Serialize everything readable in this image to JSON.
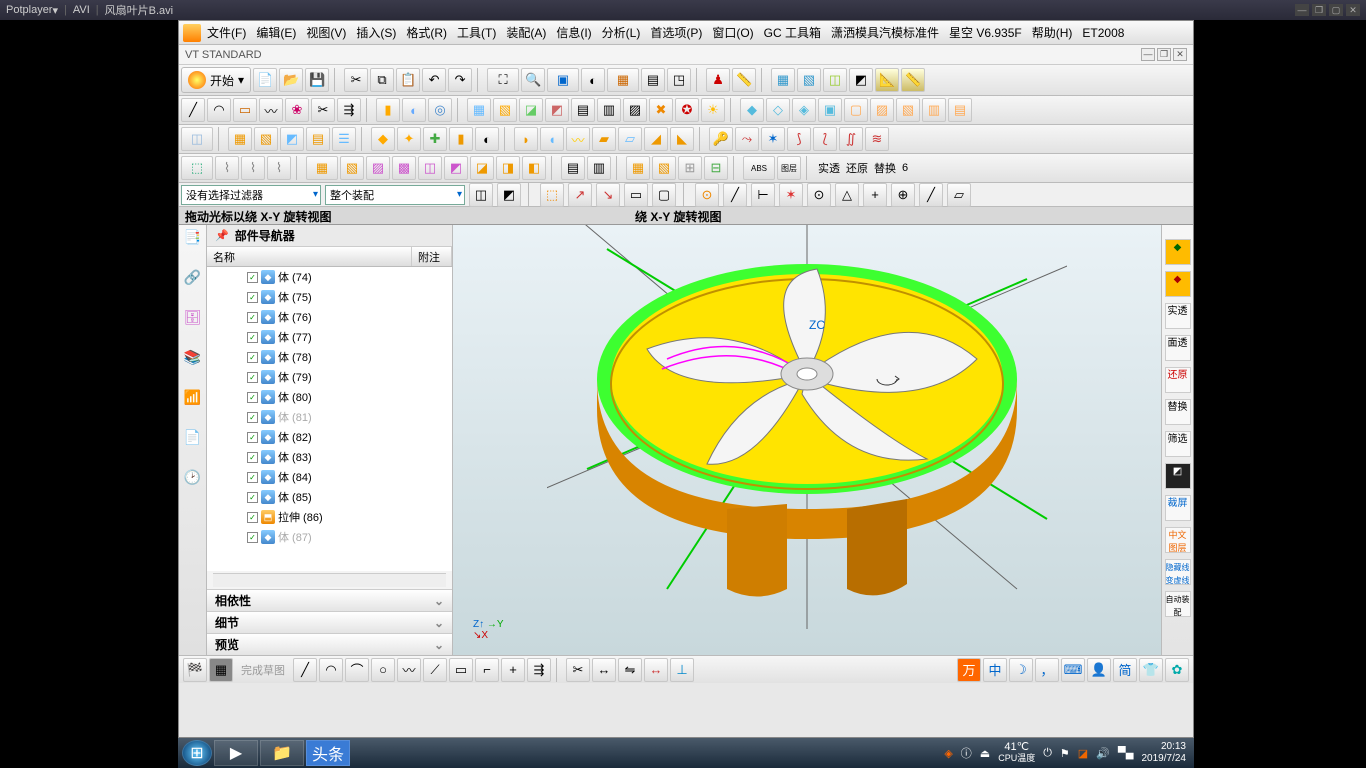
{
  "player": {
    "name": "Potplayer",
    "fmt": "AVI",
    "file": "风扇叶片B.avi"
  },
  "menu": [
    "文件(F)",
    "编辑(E)",
    "视图(V)",
    "插入(S)",
    "格式(R)",
    "工具(T)",
    "装配(A)",
    "信息(I)",
    "分析(L)",
    "首选项(P)",
    "窗口(O)",
    "GC 工具箱",
    "潇洒模具汽模标准件",
    "星空 V6.935F",
    "帮助(H)",
    "ET2008"
  ],
  "vt": "VT STANDARD",
  "start": "开始",
  "filter1": "没有选择过滤器",
  "filter2": "整个装配",
  "status_left": "拖动光标以绕 X-Y 旋转视图",
  "status_mid": "绕 X-Y 旋转视图",
  "nav": {
    "title": "部件导航器",
    "col1": "名称",
    "col2": "附注",
    "items": [
      {
        "t": "体 (74)"
      },
      {
        "t": "体 (75)"
      },
      {
        "t": "体 (76)"
      },
      {
        "t": "体 (77)"
      },
      {
        "t": "体 (78)"
      },
      {
        "t": "体 (79)"
      },
      {
        "t": "体 (80)"
      },
      {
        "t": "体 (81)",
        "dim": true
      },
      {
        "t": "体 (82)"
      },
      {
        "t": "体 (83)"
      },
      {
        "t": "体 (84)"
      },
      {
        "t": "体 (85)"
      },
      {
        "t": "拉伸 (86)",
        "ext": true
      },
      {
        "t": "体 (87)",
        "dim": true
      }
    ],
    "sec1": "相依性",
    "sec2": "细节",
    "sec3": "预览"
  },
  "right": [
    "实透",
    "面透",
    "还原",
    "替换",
    "筛选"
  ],
  "topright": [
    "实透",
    "还原",
    "替换",
    "6"
  ],
  "bottom_hint": "完成草图",
  "tray": {
    "temp": "41℃",
    "cpu": "CPU温度",
    "time": "20:13",
    "date": "2019/7/24",
    "ime": "中",
    "simp": "简"
  },
  "axis": {
    "zc": "ZC"
  }
}
